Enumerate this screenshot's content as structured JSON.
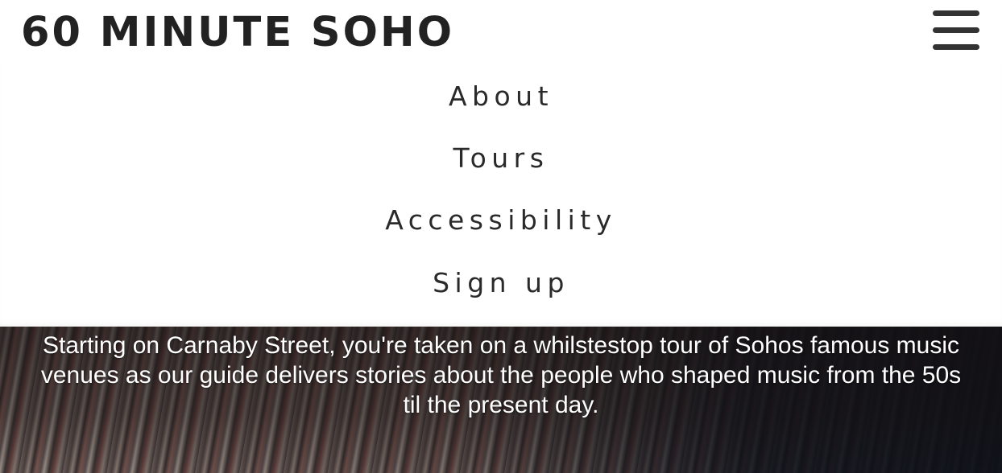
{
  "header": {
    "brand": "60 MINUTE SOHO",
    "menu_icon": "hamburger-menu-icon"
  },
  "menu": {
    "items": [
      {
        "label": "About"
      },
      {
        "label": "Tours"
      },
      {
        "label": "Accessibility"
      },
      {
        "label": "Sign up"
      }
    ]
  },
  "hero": {
    "description": "Starting on Carnaby Street, you're taken on a whilstestop tour of Sohos famous music venues as our guide delivers stories about the people who shaped music from the 50s til the present day."
  },
  "colors": {
    "text_dark": "#222222",
    "background": "#ffffff",
    "hero_text": "#ffffff"
  }
}
